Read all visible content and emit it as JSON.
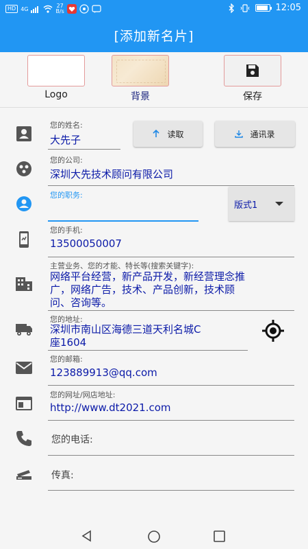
{
  "status_bar": {
    "left_chip": "HD",
    "network": "4G",
    "speed_value": "27",
    "speed_unit": "B/s",
    "time": "12:05"
  },
  "app_bar": {
    "title": "[添加新名片]"
  },
  "top_actions": {
    "logo_label": "Logo",
    "background_label": "背景",
    "save_label": "保存"
  },
  "form": {
    "name": {
      "label": "您的姓名:",
      "value": "大先子"
    },
    "read_button": "读取",
    "contacts_button": "通讯录",
    "company": {
      "label": "您的公司:",
      "value": "深圳大先技术顾问有限公司"
    },
    "position": {
      "label": "您的职务:",
      "value": ""
    },
    "style_select": {
      "selected": "版式1"
    },
    "phone": {
      "label": "您的手机:",
      "value": "13500050007"
    },
    "business": {
      "label": "主营业务、您的才能、特长等(搜索关键字):",
      "lines": [
        "网络平台经营，新产品开发，新经营理念推",
        "广，网络广告，技术、产品创新，技术顾",
        "问、咨询等。"
      ]
    },
    "address": {
      "label": "您的地址:",
      "lines": [
        "深圳市南山区海德三道天利名城C",
        "座1604"
      ]
    },
    "email": {
      "label": "您的邮箱:",
      "value": "123889913@qq.com"
    },
    "website": {
      "label": "您的网址/网店地址:",
      "value": "http://www.dt2021.com"
    },
    "telephone": {
      "placeholder": "您的电话:"
    },
    "fax": {
      "placeholder": "传真:"
    }
  },
  "colors": {
    "primary": "#2196f3",
    "value_text": "#0b1aa8",
    "icon_gray": "#555555",
    "active_icon": "#2196f3"
  }
}
